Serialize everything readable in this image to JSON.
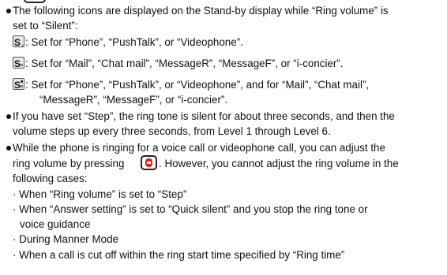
{
  "colors": {
    "button_red": "#e2231a",
    "text": "#111111"
  },
  "lines": [
    "The following icons are displayed on the Stand-by display while “Ring volume” is",
    "set to “Silent”:",
    ": Set for “Phone”, “PushTalk”, or “Videophone”.",
    ": Set for “Mail”, “Chat mail”, “MessageR”, “MessageF”, or “i-concier”.",
    ": Set for “Phone”, “PushTalk”, or “Videophone”, and for “Mail”, “Chat mail”,",
    "“MessageR”, “MessageF”, or “i-concier”.",
    "If you have set “Step”, the ring tone is silent for about three seconds, and then the",
    "volume steps up every three seconds, from Level 1 through Level 6.",
    "While the phone is ringing for a voice call or videophone call, you can adjust the",
    "ring volume by pressing",
    ". However, you cannot adjust the ring volume in the",
    "following cases:",
    "· When “Ring volume” is set to “Step”",
    "· When “Answer setting” is set to “Quick silent” and you stop the ring tone or",
    "voice guidance",
    "· During Manner Mode",
    "· When a call is cut off within the ring start time specified by “Ring time”"
  ],
  "icons": [
    "silent-phone-icon",
    "silent-mail-icon",
    "silent-phone-mail-icon",
    "side-key-button-icon"
  ]
}
